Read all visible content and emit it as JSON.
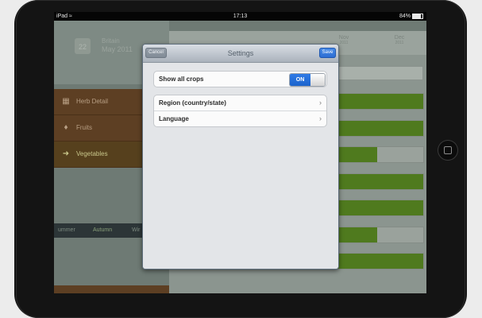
{
  "statusbar": {
    "device": "iPad",
    "time": "17:13",
    "battery": "84%",
    "battery_level": 0.84
  },
  "background": {
    "date": {
      "place": "Britain",
      "month": "May 2011",
      "day": "22"
    },
    "categories": [
      {
        "label": "Herb Detail",
        "icon": "herb-icon"
      },
      {
        "label": "Fruits",
        "icon": "pear-icon"
      },
      {
        "label": "Vegetables",
        "icon": "carrot-icon"
      }
    ],
    "seasons": {
      "items": [
        "ummer",
        "Autumn",
        "Wir"
      ],
      "selected": "Autumn"
    },
    "months": [
      {
        "label": "Nov",
        "year": "2011"
      },
      {
        "label": "Dec",
        "year": "2011"
      }
    ],
    "bars": [
      1.0,
      1.0,
      0.77,
      1.0,
      1.0,
      0.77,
      1.0
    ]
  },
  "popover": {
    "title": "Settings",
    "cancel_label": "Cancel",
    "save_label": "Save",
    "show_all_crops": {
      "label": "Show all crops",
      "value": "ON"
    },
    "rows": [
      {
        "label": "Region (country/state)",
        "chevron": "›"
      },
      {
        "label": "Language",
        "chevron": "›"
      }
    ]
  },
  "colors": {
    "accent_blue": "#2a6ad1",
    "bar_green": "#4f7a1e",
    "category_brown": "#5d3f23"
  }
}
